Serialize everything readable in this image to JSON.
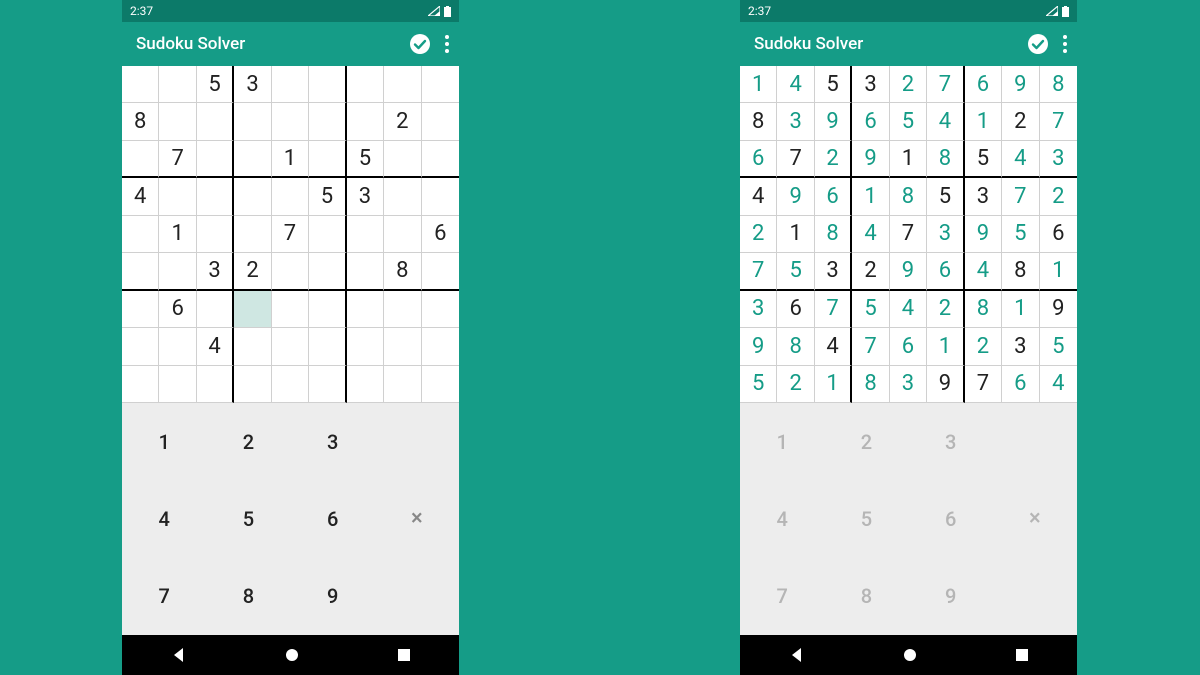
{
  "status": {
    "time": "2:37"
  },
  "app": {
    "title": "Sudoku Solver"
  },
  "keypad": {
    "keys": [
      "1",
      "2",
      "3",
      "4",
      "5",
      "6",
      "7",
      "8",
      "9"
    ],
    "clear": "×"
  },
  "colors": {
    "accent": "#159c87",
    "statusbar": "#0c7a69"
  },
  "left": {
    "selected": [
      6,
      3
    ],
    "grid": [
      [
        "",
        "",
        "5",
        "3",
        "",
        "",
        "",
        "",
        ""
      ],
      [
        "8",
        "",
        "",
        "",
        "",
        "",
        "",
        "2",
        ""
      ],
      [
        "",
        "7",
        "",
        "",
        "1",
        "",
        "5",
        "",
        ""
      ],
      [
        "4",
        "",
        "",
        "",
        "",
        "5",
        "3",
        "",
        ""
      ],
      [
        "",
        "1",
        "",
        "",
        "7",
        "",
        "",
        "",
        "6"
      ],
      [
        "",
        "",
        "3",
        "2",
        "",
        "",
        "",
        "8",
        ""
      ],
      [
        "",
        "6",
        "",
        "",
        "",
        "",
        "",
        "",
        ""
      ],
      [
        "",
        "",
        "4",
        "",
        "",
        "",
        "",
        "",
        ""
      ],
      [
        "",
        "",
        "",
        "",
        "",
        "",
        "",
        "",
        ""
      ]
    ]
  },
  "right": {
    "given": [
      [
        0,
        0,
        1,
        1,
        0,
        0,
        0,
        0,
        0
      ],
      [
        1,
        0,
        0,
        0,
        0,
        0,
        0,
        1,
        0
      ],
      [
        0,
        1,
        0,
        0,
        1,
        0,
        1,
        0,
        0
      ],
      [
        1,
        0,
        0,
        0,
        0,
        1,
        1,
        0,
        0
      ],
      [
        0,
        1,
        0,
        0,
        1,
        0,
        0,
        0,
        1
      ],
      [
        0,
        0,
        1,
        1,
        0,
        0,
        0,
        1,
        0
      ],
      [
        0,
        1,
        0,
        0,
        0,
        0,
        0,
        0,
        1
      ],
      [
        0,
        0,
        1,
        0,
        0,
        0,
        0,
        1,
        0
      ],
      [
        0,
        0,
        0,
        0,
        0,
        1,
        1,
        0,
        0
      ]
    ],
    "grid": [
      [
        "1",
        "4",
        "5",
        "3",
        "2",
        "7",
        "6",
        "9",
        "8"
      ],
      [
        "8",
        "3",
        "9",
        "6",
        "5",
        "4",
        "1",
        "2",
        "7"
      ],
      [
        "6",
        "7",
        "2",
        "9",
        "1",
        "8",
        "5",
        "4",
        "3"
      ],
      [
        "4",
        "9",
        "6",
        "1",
        "8",
        "5",
        "3",
        "7",
        "2"
      ],
      [
        "2",
        "1",
        "8",
        "4",
        "7",
        "3",
        "9",
        "5",
        "6"
      ],
      [
        "7",
        "5",
        "3",
        "2",
        "9",
        "6",
        "4",
        "8",
        "1"
      ],
      [
        "3",
        "6",
        "7",
        "5",
        "4",
        "2",
        "8",
        "1",
        "9"
      ],
      [
        "9",
        "8",
        "4",
        "7",
        "6",
        "1",
        "2",
        "3",
        "5"
      ],
      [
        "5",
        "2",
        "1",
        "8",
        "3",
        "9",
        "7",
        "6",
        "4"
      ]
    ]
  }
}
